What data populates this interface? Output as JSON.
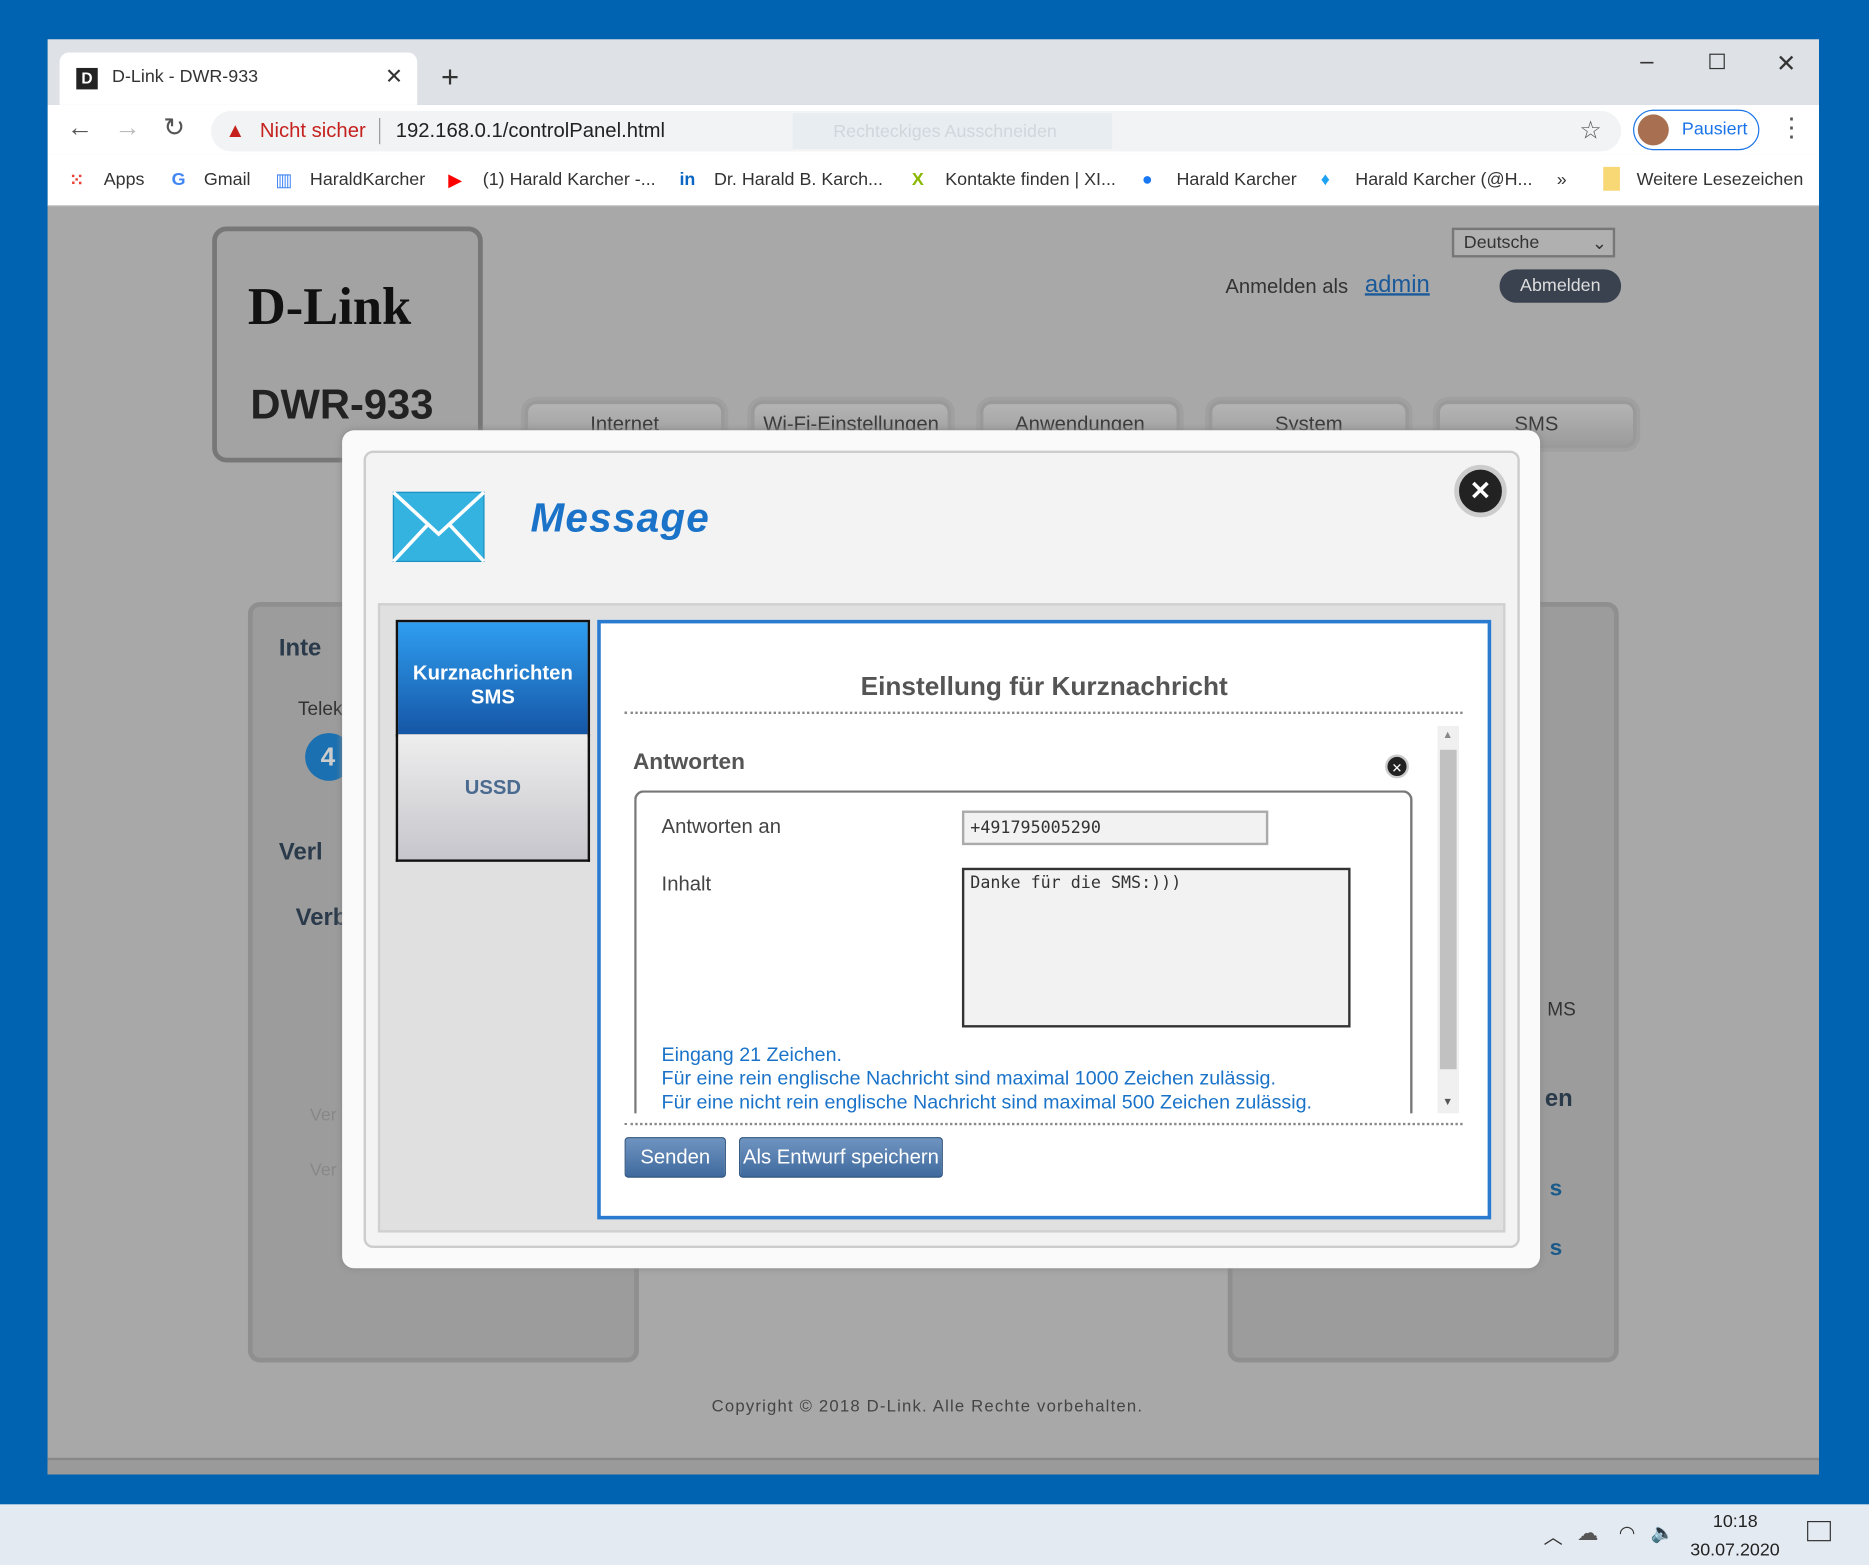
{
  "browser": {
    "tab_title": "D-Link - DWR-933",
    "new_tab": "+",
    "security_label": "Nicht sicher",
    "url": "192.168.0.1/controlPanel.html",
    "overlay_hint": "Rechteckiges Ausschneiden",
    "profile_label": "Pausiert",
    "bookmarks": [
      "Apps",
      "Gmail",
      "HaraldKarcher",
      "(1) Harald Karcher -...",
      "Dr. Harald B. Karch...",
      "Kontakte finden | XI...",
      "Harald Karcher",
      "Harald Karcher (@H..."
    ],
    "more": "»",
    "other_bookmarks": "Weitere Lesezeichen"
  },
  "router": {
    "brand": "D-Link",
    "model": "DWR-933",
    "language": "Deutsche",
    "login_label": "Anmelden als",
    "user": "admin",
    "logout": "Abmelden",
    "nav": [
      "Internet",
      "Wi-Fi-Einstellungen",
      "Anwendungen",
      "System",
      "SMS"
    ],
    "bg_left": [
      "Inte",
      "Telek",
      "4",
      "Verl",
      "Verb",
      "Ver",
      "Ver"
    ],
    "bg_right": [
      "MS",
      "en",
      "s",
      "s"
    ],
    "copyright": "Copyright © 2018 D-Link. Alle Rechte vorbehalten."
  },
  "modal": {
    "title": "Message",
    "tabs": [
      "Kurznachrichten SMS",
      "USSD"
    ],
    "heading": "Einstellung für Kurznachricht",
    "section": "Antworten",
    "reply_to_label": "Antworten an",
    "reply_to_value": "+491795005290",
    "content_label": "Inhalt",
    "content_value": "Danke für die SMS:)))",
    "info": [
      "Eingang 21 Zeichen.",
      "Für eine rein englische Nachricht sind maximal 1000 Zeichen zulässig.",
      "Für eine nicht rein englische Nachricht sind maximal 500 Zeichen zulässig."
    ],
    "send": "Senden",
    "save_draft": "Als Entwurf speichern"
  },
  "taskbar": {
    "time": "10:18",
    "date": "30.07.2020"
  }
}
